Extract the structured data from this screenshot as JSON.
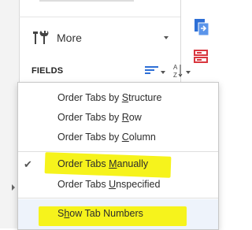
{
  "header": {
    "more_label": "More",
    "fields_label": "FIELDS"
  },
  "icons": {
    "tools": "tools-icon",
    "sort": "sort-lines-icon",
    "az": "az-sort-icon",
    "export": "export-pdf-icon",
    "form": "form-fields-icon"
  },
  "menu": {
    "items": [
      {
        "pre": "Order Tabs by ",
        "key": "S",
        "post": "tructure",
        "checked": false,
        "highlighted": false
      },
      {
        "pre": "Order Tabs by ",
        "key": "R",
        "post": "ow",
        "checked": false,
        "highlighted": false
      },
      {
        "pre": "Order Tabs by ",
        "key": "C",
        "post": "olumn",
        "checked": false,
        "highlighted": false
      },
      {
        "pre": "Order Tabs ",
        "key": "M",
        "post": "anually",
        "checked": true,
        "highlighted": true
      },
      {
        "pre": "Order Tabs ",
        "key": "U",
        "post": "nspecified",
        "checked": false,
        "highlighted": false
      }
    ],
    "footer": {
      "pre": "S",
      "key": "h",
      "post": "ow Tab Numbers",
      "highlighted": true
    },
    "checkmark": "✔"
  },
  "colors": {
    "highlight": "#f6f31c",
    "accent_red": "#d9363e",
    "accent_blue": "#2d6fd6"
  }
}
